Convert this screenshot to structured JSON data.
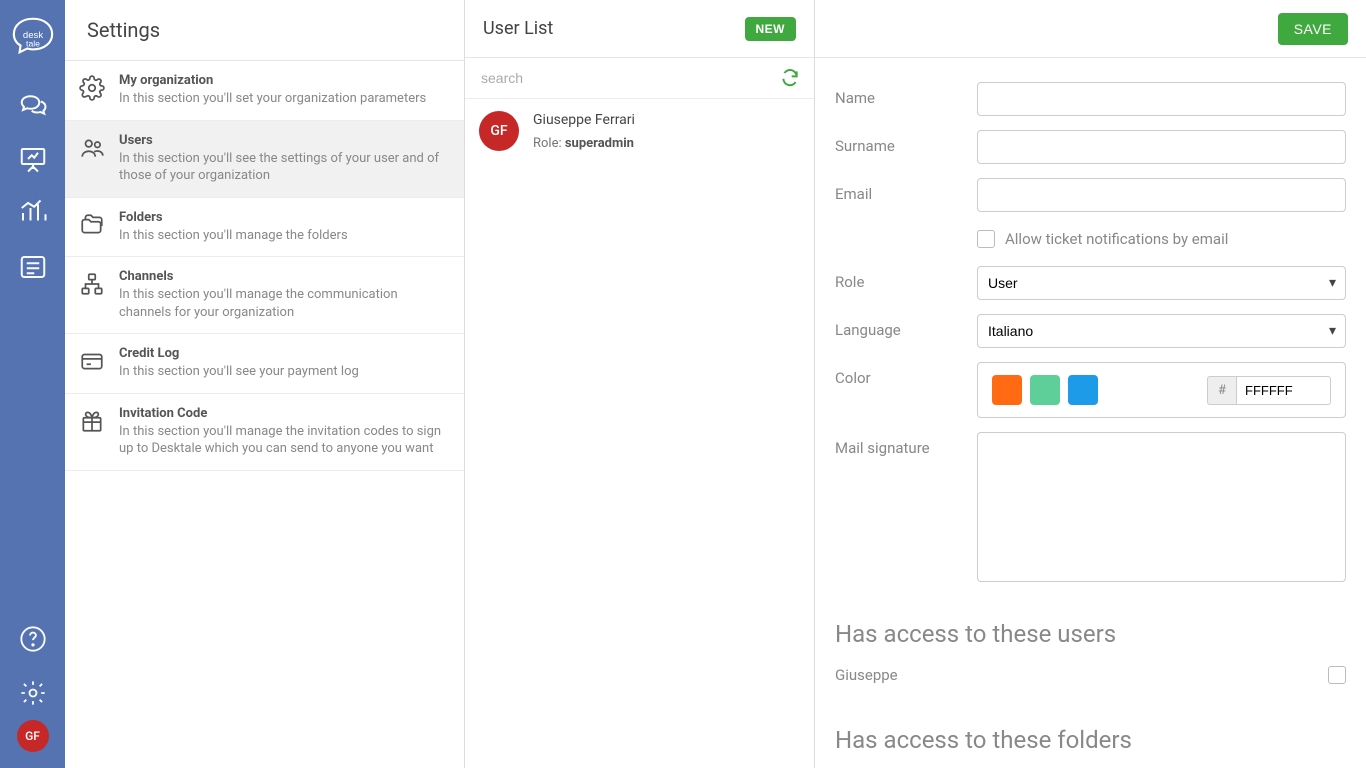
{
  "brand": "desk tale",
  "settings": {
    "title": "Settings",
    "items": [
      {
        "title": "My organization",
        "desc": "In this section you'll set your organization parameters"
      },
      {
        "title": "Users",
        "desc": "In this section you'll see the settings of your user and of those of your organization"
      },
      {
        "title": "Folders",
        "desc": "In this section you'll manage the folders"
      },
      {
        "title": "Channels",
        "desc": "In this section you'll manage the communication channels for your organization"
      },
      {
        "title": "Credit Log",
        "desc": "In this section you'll see your payment log"
      },
      {
        "title": "Invitation Code",
        "desc": "In this section you'll manage the invitation codes to sign up to Desktale which you can send to anyone you want"
      }
    ]
  },
  "userlist": {
    "title": "User List",
    "new_label": "NEW",
    "search_placeholder": "search",
    "users": [
      {
        "initials": "GF",
        "name": "Giuseppe Ferrari",
        "role_prefix": "Role: ",
        "role": "superadmin"
      }
    ]
  },
  "detail": {
    "save_label": "SAVE",
    "labels": {
      "name": "Name",
      "surname": "Surname",
      "email": "Email",
      "allow_notifications": "Allow ticket notifications by email",
      "role": "Role",
      "language": "Language",
      "color": "Color",
      "mail_signature": "Mail signature"
    },
    "values": {
      "name": "",
      "surname": "",
      "email": "",
      "role": "User",
      "language": "Italiano",
      "hex": "FFFFFF",
      "hex_prefix": "#"
    },
    "swatches": [
      "#ff6a13",
      "#5fcf9a",
      "#1e9be8"
    ],
    "access_users_heading": "Has access to these users",
    "access_users": [
      "Giuseppe"
    ],
    "access_folders_heading": "Has access to these folders"
  },
  "rail_avatar_initials": "GF"
}
